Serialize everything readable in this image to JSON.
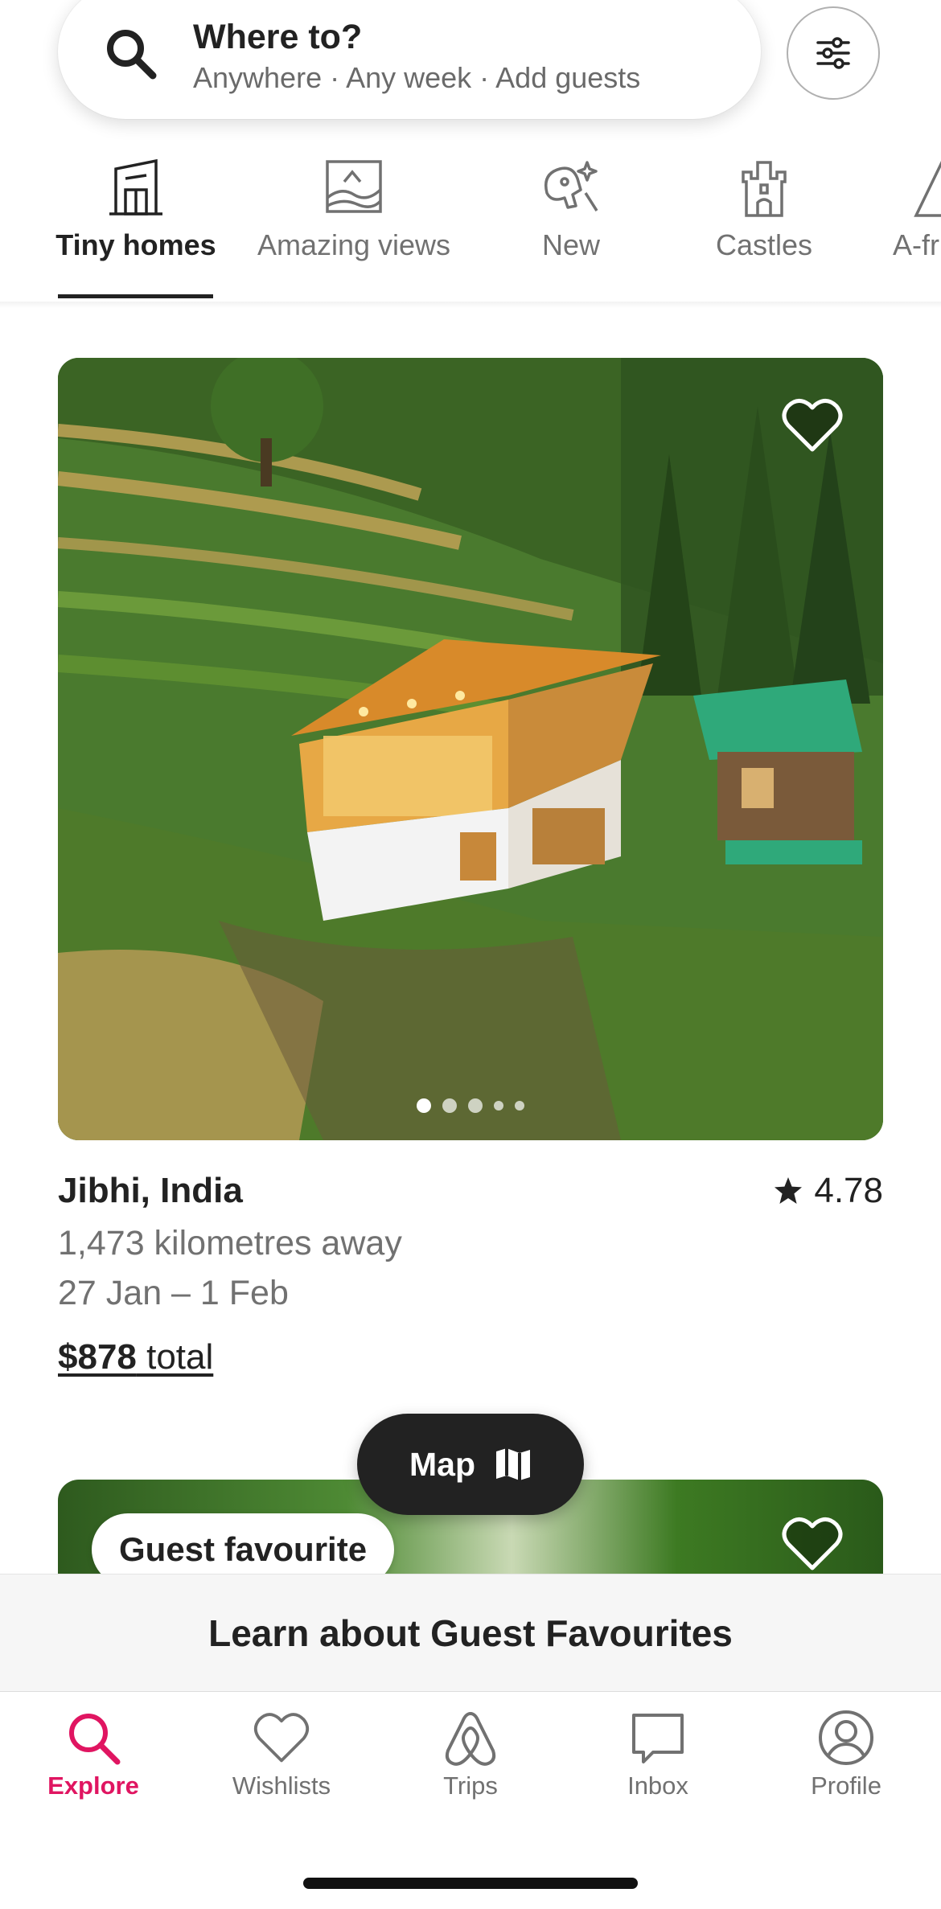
{
  "search": {
    "title": "Where to?",
    "subtitle": "Anywhere · Any week · Add guests"
  },
  "categories": [
    {
      "label": "Tiny homes",
      "icon": "tiny-home-icon",
      "active": true
    },
    {
      "label": "Amazing views",
      "icon": "amazing-views-icon",
      "active": false
    },
    {
      "label": "New",
      "icon": "new-icon",
      "active": false
    },
    {
      "label": "Castles",
      "icon": "castle-icon",
      "active": false
    },
    {
      "label": "A-fr",
      "icon": "a-frame-icon",
      "active": false
    }
  ],
  "listing": {
    "location": "Jibhi, India",
    "rating": "4.78",
    "distance": "1,473 kilometres away",
    "dates": "27 Jan – 1 Feb",
    "price": "$878",
    "price_suffix": " total",
    "photo_count": 5,
    "active_photo": 1
  },
  "next_listing": {
    "badge": "Guest favourite"
  },
  "map_button": {
    "label": "Map"
  },
  "banner": {
    "text": "Learn about Guest Favourites"
  },
  "nav": [
    {
      "label": "Explore",
      "icon": "search-icon",
      "active": true
    },
    {
      "label": "Wishlists",
      "icon": "heart-icon",
      "active": false
    },
    {
      "label": "Trips",
      "icon": "airbnb-logo-icon",
      "active": false
    },
    {
      "label": "Inbox",
      "icon": "message-icon",
      "active": false
    },
    {
      "label": "Profile",
      "icon": "profile-icon",
      "active": false
    }
  ],
  "colors": {
    "accent": "#e01561",
    "text": "#222222",
    "muted": "#717171"
  }
}
